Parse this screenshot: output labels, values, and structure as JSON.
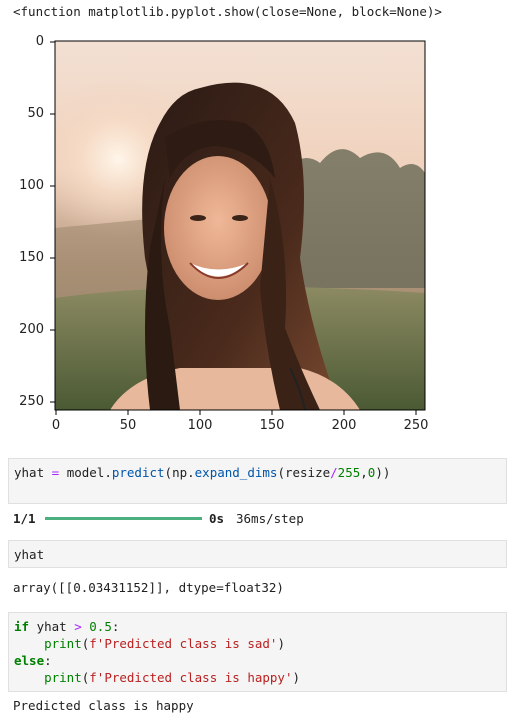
{
  "output_repr": "<function matplotlib.pyplot.show(close=None, block=None)>",
  "figure": {
    "y_ticks": [
      "0",
      "50",
      "100",
      "150",
      "200",
      "250"
    ],
    "x_ticks": [
      "0",
      "50",
      "100",
      "150",
      "200",
      "250"
    ],
    "image_subject": "photo of smiling woman with long hair outdoors at sunset"
  },
  "cell_predict": {
    "tokens": [
      {
        "t": "yhat ",
        "c": "plain"
      },
      {
        "t": "=",
        "c": "op"
      },
      {
        "t": " model.",
        "c": "plain"
      },
      {
        "t": "predict",
        "c": "fn"
      },
      {
        "t": "(np.",
        "c": "plain"
      },
      {
        "t": "expand_dims",
        "c": "fn"
      },
      {
        "t": "(resize",
        "c": "plain"
      },
      {
        "t": "/",
        "c": "op"
      },
      {
        "t": "255",
        "c": "num"
      },
      {
        "t": ",",
        "c": "plain"
      },
      {
        "t": "0",
        "c": "num"
      },
      {
        "t": "))",
        "c": "plain"
      }
    ]
  },
  "progress": {
    "step": "1/1",
    "fraction": 1.0,
    "time": "0s",
    "rate": "36ms/step"
  },
  "cell_yhat": {
    "code": "yhat"
  },
  "yhat_output": "array([[0.03431152]], dtype=float32)",
  "cell_if": {
    "lines": [
      [
        {
          "t": "if",
          "c": "kw"
        },
        {
          "t": " yhat ",
          "c": "plain"
        },
        {
          "t": ">",
          "c": "op"
        },
        {
          "t": " ",
          "c": "plain"
        },
        {
          "t": "0.5",
          "c": "num"
        },
        {
          "t": ":",
          "c": "plain"
        }
      ],
      [
        {
          "t": "    ",
          "c": "plain"
        },
        {
          "t": "print",
          "c": "kw2"
        },
        {
          "t": "(",
          "c": "plain"
        },
        {
          "t": "f'Predicted class is sad'",
          "c": "str"
        },
        {
          "t": ")",
          "c": "plain"
        }
      ],
      [
        {
          "t": "else",
          "c": "kw"
        },
        {
          "t": ":",
          "c": "plain"
        }
      ],
      [
        {
          "t": "    ",
          "c": "plain"
        },
        {
          "t": "print",
          "c": "kw2"
        },
        {
          "t": "(",
          "c": "plain"
        },
        {
          "t": "f'Predicted class is happy'",
          "c": "str"
        },
        {
          "t": ")",
          "c": "plain"
        }
      ]
    ]
  },
  "final_output": "Predicted class is happy"
}
